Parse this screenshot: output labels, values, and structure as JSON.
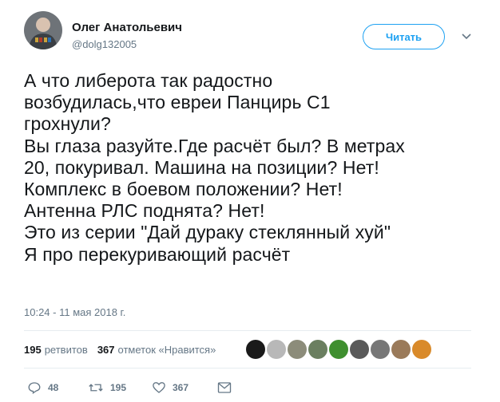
{
  "user": {
    "name": "Олег Анатольевич",
    "handle": "@dolg132005"
  },
  "header": {
    "follow_label": "Читать",
    "more_icon": "chevron-down-icon"
  },
  "tweet": {
    "text": "А что либерота так радостно\nвозбудилась,что евреи Панцирь С1\nгрохнули?\nВы глаза разуйте.Где расчёт был? В метрах\n20, покуривал. Машина на позиции? Нет!\nКомплекс в боевом положении? Нет!\nАнтенна РЛС поднята? Нет!\nЭто из серии \"Дай дураку стеклянный хуй\"\nЯ про перекуривающий расчёт",
    "timestamp": "10:24 - 11 мая 2018 г."
  },
  "stats": {
    "retweets_count": "195",
    "retweets_label": "ретвитов",
    "likes_count": "367",
    "likes_label": "отметок «Нравится»"
  },
  "likers": [
    {
      "name": "liker-avatar-1",
      "color": "#1a1a1a"
    },
    {
      "name": "liker-avatar-2",
      "color": "#b8b8b8"
    },
    {
      "name": "liker-avatar-3",
      "color": "#8c8c7a"
    },
    {
      "name": "liker-avatar-4",
      "color": "#6b7f60"
    },
    {
      "name": "liker-avatar-5",
      "color": "#3f8f2f"
    },
    {
      "name": "liker-avatar-6",
      "color": "#5a5a5a"
    },
    {
      "name": "liker-avatar-7",
      "color": "#777777"
    },
    {
      "name": "liker-avatar-8",
      "color": "#9a7a5a"
    },
    {
      "name": "liker-avatar-9",
      "color": "#d98a2a"
    }
  ],
  "actions": {
    "reply_count": "48",
    "retweet_count": "195",
    "like_count": "367"
  },
  "colors": {
    "accent": "#1da1f2",
    "muted": "#657786",
    "text": "#14171a",
    "divider": "#e6ecf0"
  }
}
